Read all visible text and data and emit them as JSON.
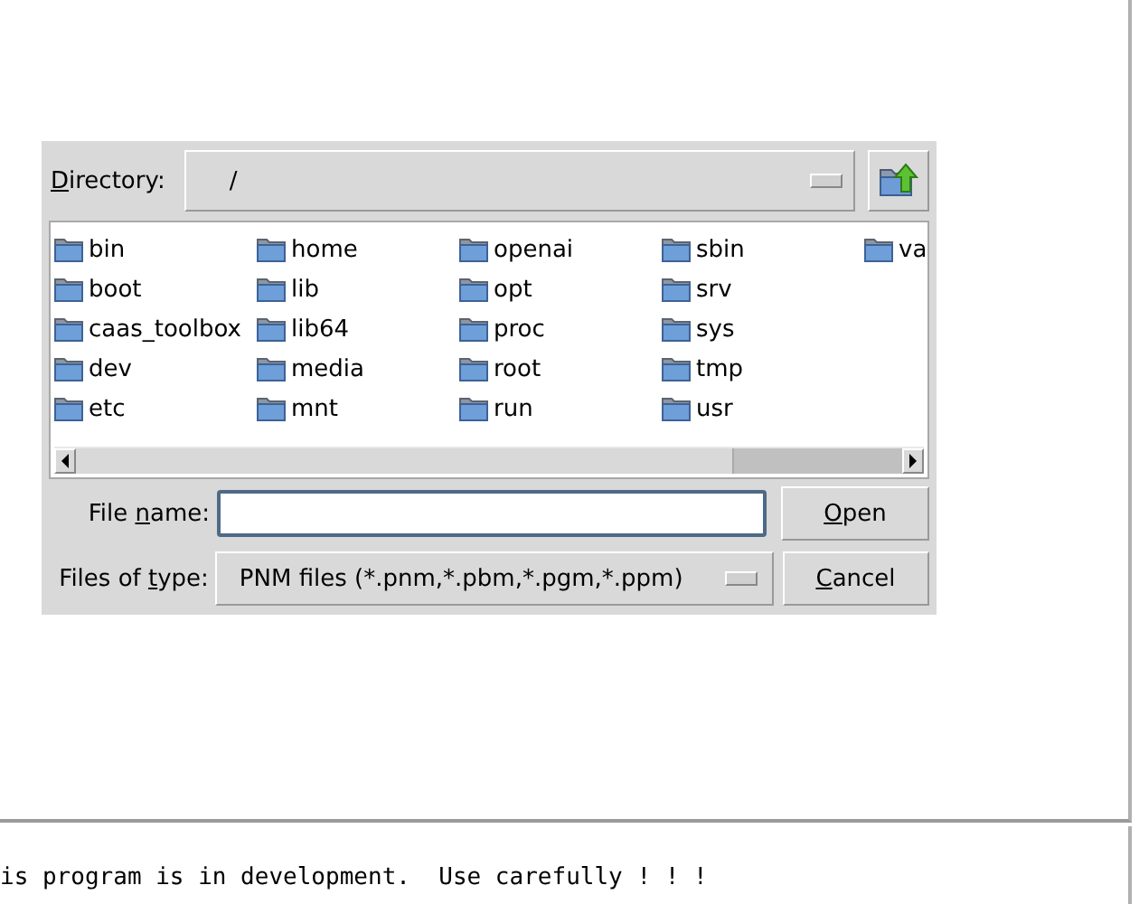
{
  "dialog": {
    "directory": {
      "label": {
        "key": "D",
        "after": "irectory:"
      },
      "value": "/"
    },
    "folders": [
      {
        "name": "bin"
      },
      {
        "name": "boot"
      },
      {
        "name": "caas_toolbox"
      },
      {
        "name": "dev"
      },
      {
        "name": "etc"
      },
      {
        "name": "home"
      },
      {
        "name": "lib"
      },
      {
        "name": "lib64"
      },
      {
        "name": "media"
      },
      {
        "name": "mnt"
      },
      {
        "name": "openai"
      },
      {
        "name": "opt"
      },
      {
        "name": "proc"
      },
      {
        "name": "root"
      },
      {
        "name": "run"
      },
      {
        "name": "sbin"
      },
      {
        "name": "srv"
      },
      {
        "name": "sys"
      },
      {
        "name": "tmp"
      },
      {
        "name": "usr"
      },
      {
        "name": "va"
      }
    ],
    "file_name": {
      "label": {
        "before": "File ",
        "key": "n",
        "after": "ame:"
      }
    },
    "file_type": {
      "label": {
        "before": "Files of ",
        "key": "t",
        "after": "ype:"
      },
      "value": "PNM files (*.pnm,*.pbm,*.pgm,*.ppm)"
    },
    "buttons": [
      {
        "key": "O",
        "after": "pen"
      },
      {
        "key": "C",
        "after": "ancel"
      }
    ]
  },
  "console": {
    "text": "is program is in development.  Use carefully ! ! !"
  }
}
